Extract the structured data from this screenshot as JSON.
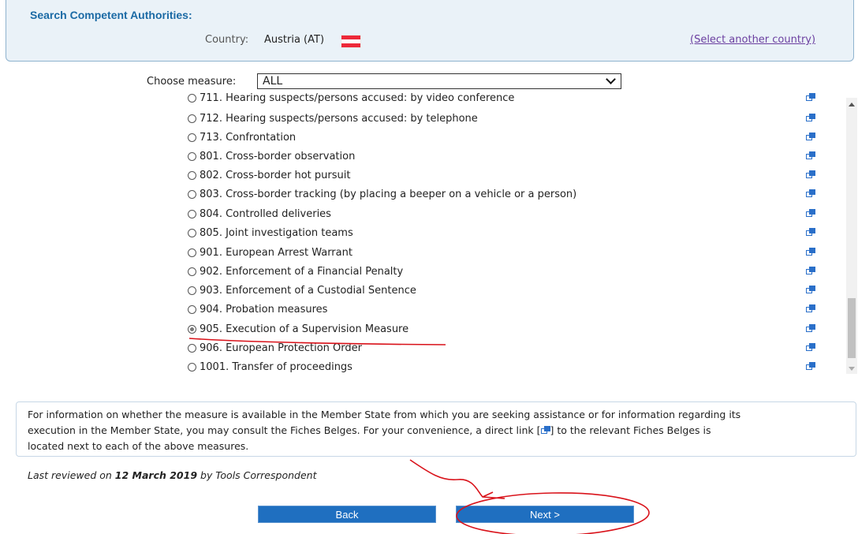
{
  "search": {
    "title": "Search Competent Authorities:",
    "country_label": "Country:",
    "country_value": "Austria (AT)",
    "flag_colors": [
      "#ed2939",
      "#ffffff",
      "#ed2939"
    ],
    "select_another": "(Select another country)"
  },
  "measure": {
    "label": "Choose measure:",
    "selected": "ALL"
  },
  "measures": [
    {
      "label": "711. Hearing suspects/persons accused: by video conference",
      "selected": false
    },
    {
      "label": "712. Hearing suspects/persons accused: by telephone",
      "selected": false
    },
    {
      "label": "713. Confrontation",
      "selected": false
    },
    {
      "label": "801. Cross-border observation",
      "selected": false
    },
    {
      "label": "802. Cross-border hot pursuit",
      "selected": false
    },
    {
      "label": "803. Cross-border tracking (by placing a beeper on a vehicle or a person)",
      "selected": false
    },
    {
      "label": "804. Controlled deliveries",
      "selected": false
    },
    {
      "label": "805. Joint investigation teams",
      "selected": false
    },
    {
      "label": "901. European Arrest Warrant",
      "selected": false
    },
    {
      "label": "902. Enforcement of a Financial Penalty",
      "selected": false
    },
    {
      "label": "903. Enforcement of a Custodial Sentence",
      "selected": false
    },
    {
      "label": "904. Probation measures",
      "selected": false
    },
    {
      "label": "905. Execution of a Supervision Measure",
      "selected": true
    },
    {
      "label": "906. European Protection Order",
      "selected": false
    },
    {
      "label": "1001. Transfer of proceedings",
      "selected": false
    }
  ],
  "info": {
    "line1": "For information on whether the measure is available in the Member State from which you are seeking assistance or for information regarding its",
    "line2a": "execution in the Member State, you may consult the Fiches Belges. For your convenience, a direct link [",
    "line2b": "] to the relevant Fiches Belges is",
    "line3": "located next to each of the above measures."
  },
  "reviewed": {
    "prefix": "Last reviewed on ",
    "date": "12 March 2019",
    "suffix": " by Tools Correspondent"
  },
  "buttons": {
    "back": "Back",
    "next": "Next >"
  },
  "colors": {
    "accent": "#1f6fc0",
    "title": "#1b6aa5",
    "link": "#6b3fa0",
    "annotation": "#d9121a"
  }
}
